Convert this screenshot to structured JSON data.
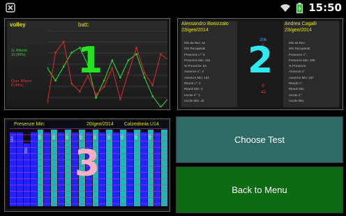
{
  "status_bar": {
    "time": "15:50",
    "icons": [
      "notification-x-icon",
      "wifi-icon",
      "battery-icon"
    ]
  },
  "panels": [
    {
      "number": "1",
      "number_color": "#23e323",
      "title": "volley",
      "subtitle": "batt:",
      "legend_a": [
        "1r. Riferim.",
        "10 (56%)"
      ],
      "legend_b": [
        "Quot. Riferim.",
        "8 (44%)"
      ],
      "chart_data": {
        "type": "line",
        "series": [
          {
            "color": "#33c433",
            "values": [
              0.52,
              0.36,
              0.54,
              0.72,
              0.78,
              0.56,
              0.14,
              0.36,
              0.62,
              0.4,
              0.62,
              0.7,
              0.4,
              0.16,
              0.02,
              0.14
            ]
          },
          {
            "color": "#c42a2a",
            "values": [
              0.08,
              0.72,
              0.86,
              0.32,
              0.22,
              0.42,
              0.18,
              0.28,
              0.52,
              0.12,
              0.46,
              0.78,
              0.46,
              0.3,
              0.7,
              0.62
            ]
          }
        ]
      }
    },
    {
      "number": "2",
      "number_color": "#2fe8f0",
      "left_name": "Alessandro Bonizzato",
      "left_date": "23/gen/2014",
      "right_name": "Andrea Cagalli",
      "right_date": "23/gen/2014",
      "rows": [
        "Min da Rec: 42",
        "Min Recuperati",
        "Presenze n°: 5",
        "Presenze Min: 164",
        "% Presenze: 53",
        "Assenze n°: 4",
        "Assenze Min: 164",
        "Ritardi n°: 0",
        "Ritardi Min: 0",
        "Uscite n°: 1",
        "Uscite Min: 42"
      ],
      "right_rows": [
        "Min da Rec:",
        "Min Recuperati:",
        "Presenze n°:",
        "Presenze Min: 206",
        "% Presenze:",
        "Assenze n°:",
        "Assenze Min: 247",
        "Ritardi n°:",
        "Ritardi Min:",
        "Uscite n°:",
        "Uscite Min:"
      ],
      "values": [
        {
          "v": "206",
          "c": "#4fa6ff"
        },
        {
          "v": "0",
          "c": "#ff3a3a"
        },
        {
          "v": "",
          "c": "#ff3a3a"
        },
        {
          "v": "",
          "c": "#ff3a3a"
        },
        {
          "v": "",
          "c": "#ff3a3a"
        },
        {
          "v": "",
          "c": "#ff3a3a"
        },
        {
          "v": "",
          "c": "#ff3a3a"
        },
        {
          "v": "",
          "c": "#ff3a3a"
        },
        {
          "v": "0",
          "c": "#ff3a3a"
        },
        {
          "v": "-42",
          "c": "#ff3a3a"
        }
      ]
    },
    {
      "number": "3",
      "number_color": "#ffb0c0",
      "header": "Presenze Min:",
      "date": "20/gen/2014",
      "team": "Calzedonia U14",
      "chart_data": {
        "type": "bar",
        "bars": [
          {
            "value": 0.95,
            "color": "#2323ff",
            "label": "164"
          },
          {
            "value": 0.95,
            "color": "#2323ff",
            "label": ""
          },
          {
            "value": 0.8,
            "color": "#2323ff",
            "label": "356"
          },
          {
            "value": 0.95,
            "color": "#2323ff",
            "label": ""
          },
          {
            "value": 0.98,
            "color": "#1fb6b6",
            "label": "485"
          },
          {
            "value": 0.95,
            "color": "#2323ff",
            "label": ""
          },
          {
            "value": 0.98,
            "color": "#1fb6b6",
            "label": "485"
          },
          {
            "value": 0.95,
            "color": "#2323ff",
            "label": ""
          },
          {
            "value": 0.98,
            "color": "#1fb6b6",
            "label": "485"
          },
          {
            "value": 0.95,
            "color": "#2323ff",
            "label": ""
          },
          {
            "value": 0.98,
            "color": "#1fb6b6",
            "label": "485"
          },
          {
            "value": 0.95,
            "color": "#2323ff",
            "label": ""
          },
          {
            "value": 0.98,
            "color": "#1fb6b6",
            "label": "485"
          },
          {
            "value": 0.95,
            "color": "#2323ff",
            "label": ""
          },
          {
            "value": 0.98,
            "color": "#1fb6b6",
            "label": "485"
          },
          {
            "value": 0.95,
            "color": "#2323ff",
            "label": ""
          },
          {
            "value": 0.98,
            "color": "#1fb6b6",
            "label": "485"
          },
          {
            "value": 0.95,
            "color": "#2323ff",
            "label": ""
          },
          {
            "value": 0.98,
            "color": "#1fb6b6",
            "label": "485"
          },
          {
            "value": 0.95,
            "color": "#2323ff",
            "label": ""
          },
          {
            "value": 0.98,
            "color": "#1fb6b6",
            "label": "485"
          },
          {
            "value": 0.95,
            "color": "#2323ff",
            "label": ""
          },
          {
            "value": 0.98,
            "color": "#1fb6b6",
            "label": ""
          }
        ]
      }
    }
  ],
  "buttons": {
    "choose_test": "Choose Test",
    "back_to_menu": "Back to Menu"
  }
}
